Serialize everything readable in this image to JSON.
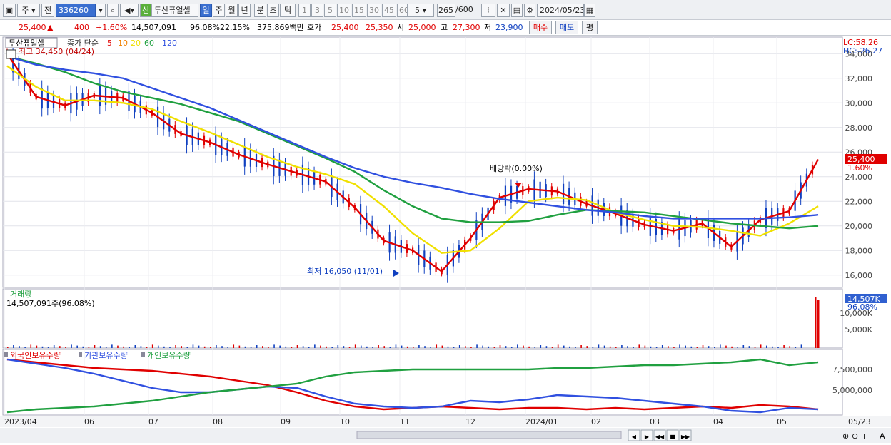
{
  "toolbar": {
    "market": "주",
    "prev": "전",
    "code": "336260",
    "name": "두산퓨얼셀",
    "badge": "신",
    "periods": [
      "일",
      "주",
      "월",
      "년",
      "분",
      "초",
      "틱"
    ],
    "active_period": "일",
    "counts": [
      "1",
      "3",
      "5",
      "10",
      "15",
      "30",
      "45",
      "60"
    ],
    "count_sel": "5",
    "range": "265",
    "range_total": "/600",
    "date": "2024/05/23"
  },
  "quote": {
    "price": "25,400",
    "arrow": "▲",
    "change": "400",
    "pct": "+1.60%",
    "volume": "14,507,091",
    "vol_ratio": "96.08%",
    "turnover": "22.15%",
    "amount": "375,869백만",
    "hoga_label": "호가",
    "ask": "25,400",
    "bid": "25,350",
    "open_label": "시",
    "open": "25,000",
    "high_label": "고",
    "high": "27,300",
    "low_label": "저",
    "low": "23,900",
    "buy": "매수",
    "sell": "매도",
    "avg": "평"
  },
  "price_panel": {
    "name": "두산퓨얼셀",
    "ma_label": "종가 단순",
    "ma_periods": [
      "5",
      "10",
      "20",
      "60",
      "120"
    ],
    "ma_colors": [
      "#e00000",
      "#f08000",
      "#f0e000",
      "#20a040",
      "#3050e0"
    ],
    "high_note": "최고 34,450 (04/24)",
    "low_note": "최저 16,050 (11/01)",
    "div_note": "배당락(0.00%)",
    "lc": "LC:58.26",
    "hc": "HC:-26.27",
    "cur_tag": "25,400",
    "cur_pct": "1.60%",
    "y_ticks": [
      "34,000",
      "32,000",
      "30,000",
      "28,000",
      "26,000",
      "24,000",
      "22,000",
      "20,000",
      "18,000",
      "16,000"
    ]
  },
  "volume_panel": {
    "title": "거래량",
    "value": "14,507,091주(96.08%)",
    "tag": "14,507K",
    "tag_pct": "96.08%",
    "y_ticks": [
      "10,000K",
      "5,000K"
    ]
  },
  "holdings_panel": {
    "legend": [
      "외국인보유수량",
      "기관보유수량",
      "개인보유수량"
    ],
    "colors": [
      "#e00000",
      "#3050e0",
      "#20a040"
    ],
    "y_ticks": [
      "7,500,000",
      "5,000,000"
    ]
  },
  "x_axis": [
    "2023/04",
    "06",
    "07",
    "08",
    "09",
    "10",
    "11",
    "12",
    "2024/01",
    "02",
    "03",
    "04",
    "05",
    "05/23"
  ],
  "chart_data": {
    "type": "line",
    "title": "두산퓨얼셀",
    "ylim": [
      15000,
      35000
    ],
    "x": [
      0,
      10,
      20,
      30,
      40,
      50,
      60,
      70,
      80,
      90,
      100,
      110,
      120,
      130,
      140,
      150,
      160,
      170,
      180,
      190,
      200,
      210,
      220,
      230,
      240,
      250,
      260,
      270,
      280
    ],
    "series": [
      {
        "name": "5",
        "values": [
          34000,
          30500,
          29800,
          30600,
          30400,
          29200,
          27500,
          26800,
          25800,
          25000,
          24300,
          23600,
          21500,
          18800,
          18000,
          16300,
          19000,
          22300,
          23000,
          22800,
          21800,
          21000,
          20100,
          19600,
          20200,
          18300,
          20500,
          21200,
          25400
        ]
      },
      {
        "name": "20",
        "values": [
          33000,
          31300,
          30200,
          30200,
          30000,
          29500,
          28500,
          27600,
          26600,
          25600,
          24800,
          24200,
          23400,
          21600,
          19400,
          17800,
          18000,
          19800,
          22000,
          22300,
          22100,
          21100,
          20500,
          20000,
          19900,
          19600,
          19200,
          20200,
          21600
        ]
      },
      {
        "name": "60",
        "values": [
          33800,
          33200,
          32500,
          31600,
          30900,
          30400,
          29900,
          29200,
          28500,
          27500,
          26500,
          25500,
          24400,
          22900,
          21600,
          20600,
          20300,
          20300,
          20400,
          20900,
          21300,
          21200,
          21100,
          20800,
          20500,
          20200,
          20000,
          19800,
          20000
        ]
      },
      {
        "name": "120",
        "values": [
          33800,
          33100,
          32700,
          32400,
          32000,
          31200,
          30400,
          29600,
          28600,
          27600,
          26600,
          25600,
          24700,
          24000,
          23500,
          23100,
          22600,
          22200,
          21900,
          21600,
          21300,
          21100,
          20800,
          20600,
          20600,
          20600,
          20600,
          20700,
          20900
        ]
      }
    ]
  }
}
